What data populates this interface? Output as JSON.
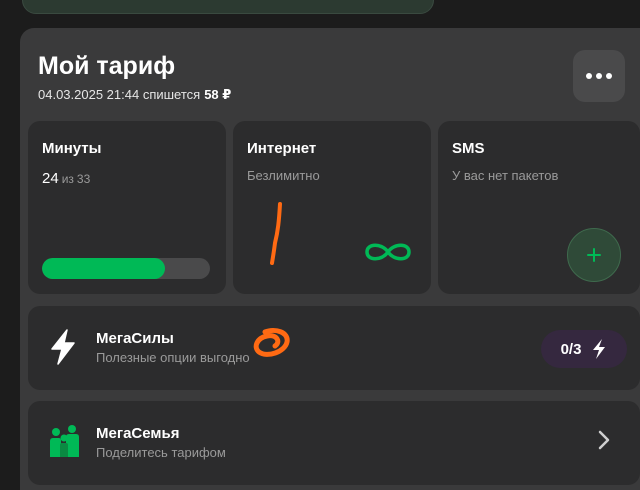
{
  "tariff": {
    "title": "Мой тариф",
    "charge_text": "04.03.2025 21:44 спишется",
    "charge_amount": "58 ₽"
  },
  "tiles": {
    "minutes": {
      "title": "Минуты",
      "used": "24",
      "of_label": "из",
      "total": "33",
      "progress": 0.73
    },
    "internet": {
      "title": "Интернет",
      "subtitle": "Безлимитно",
      "icon": "infinity-icon"
    },
    "sms": {
      "title": "SMS",
      "subtitle": "У вас нет пакетов",
      "action_icon": "plus-icon"
    }
  },
  "rows": {
    "megasily": {
      "title": "МегаСилы",
      "subtitle": "Полезные опции выгодно",
      "badge": "0/3",
      "icon": "lightning-icon"
    },
    "megasemya": {
      "title": "МегаСемья",
      "subtitle": "Поделитесь тарифом",
      "icon": "family-icon"
    }
  },
  "colors": {
    "accent": "#00b956",
    "scribble": "#ff6a13",
    "badge_bg": "#35283f"
  }
}
